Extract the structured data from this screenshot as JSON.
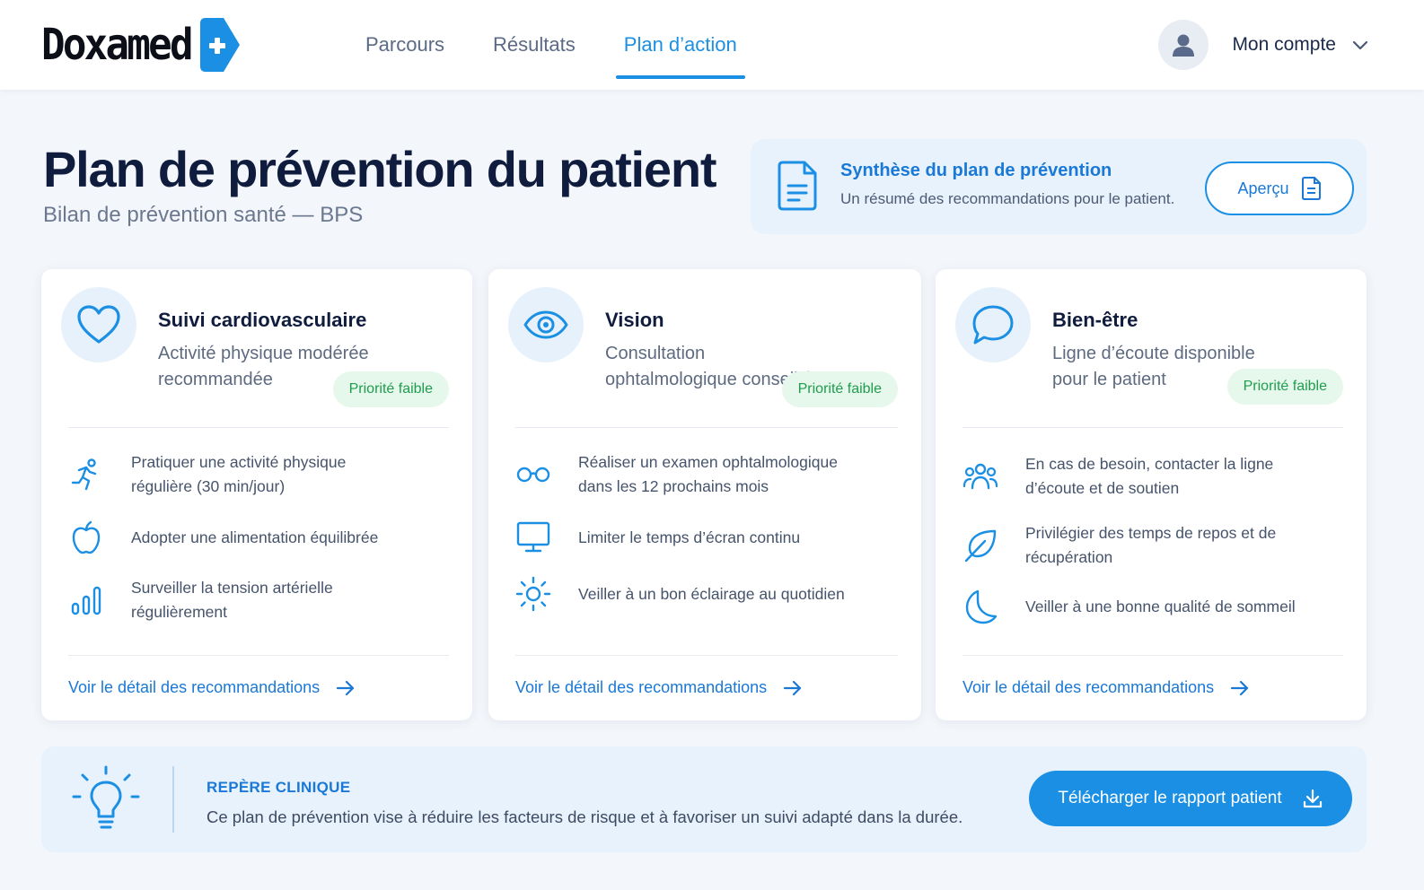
{
  "brand": {
    "name": "Doxamed",
    "accent": "#1a8fe3"
  },
  "nav": {
    "items": [
      {
        "label": "Parcours"
      },
      {
        "label": "Résultats"
      },
      {
        "label": "Plan d’action"
      }
    ],
    "active_index": 2
  },
  "account": {
    "label": "Mon compte"
  },
  "page": {
    "title": "Plan de prévention du patient",
    "subtitle": "Bilan de prévention santé — BPS"
  },
  "summary": {
    "title": "Synthèse du plan de prévention",
    "description": "Un résumé des recommandations pour le patient.",
    "button_label": "Aperçu"
  },
  "cards": [
    {
      "icon": "heart-icon",
      "title": "Suivi cardiovasculaire",
      "description": "Activité physique modérée recommandée",
      "badge": "Priorité faible",
      "items": [
        {
          "icon": "running-icon",
          "text": "Pratiquer une activité physique régulière (30 min/jour)"
        },
        {
          "icon": "apple-icon",
          "text": "Adopter une alimentation équilibrée"
        },
        {
          "icon": "bar-chart-icon",
          "text": "Surveiller la tension artérielle régulièrement"
        }
      ],
      "link": "Voir le détail des recommandations"
    },
    {
      "icon": "eye-icon",
      "title": "Vision",
      "description": "Consultation ophtalmologique conseillée",
      "badge": "Priorité faible",
      "items": [
        {
          "icon": "glasses-icon",
          "text": "Réaliser un examen ophtalmologique dans les 12 prochains mois"
        },
        {
          "icon": "monitor-icon",
          "text": "Limiter le temps d’écran continu"
        },
        {
          "icon": "sun-icon",
          "text": "Veiller à un bon éclairage au quotidien"
        }
      ],
      "link": "Voir le détail des recommandations"
    },
    {
      "icon": "chat-bubble-icon",
      "title": "Bien-être",
      "description": "Ligne d’écoute disponible pour le patient",
      "badge": "Priorité faible",
      "items": [
        {
          "icon": "people-icon",
          "text": "En cas de besoin, contacter la ligne d’écoute et de soutien"
        },
        {
          "icon": "leaf-icon",
          "text": "Privilégier des temps de repos et de récupération"
        },
        {
          "icon": "moon-icon",
          "text": "Veiller à une bonne qualité de sommeil"
        }
      ],
      "link": "Voir le détail des recommandations"
    }
  ],
  "clinical_note": {
    "heading": "REPÈRE CLINIQUE",
    "text": "Ce plan de prévention vise à réduire les facteurs de risque et à favoriser un suivi adapté dans la durée.",
    "button_label": "Télécharger le rapport patient"
  }
}
